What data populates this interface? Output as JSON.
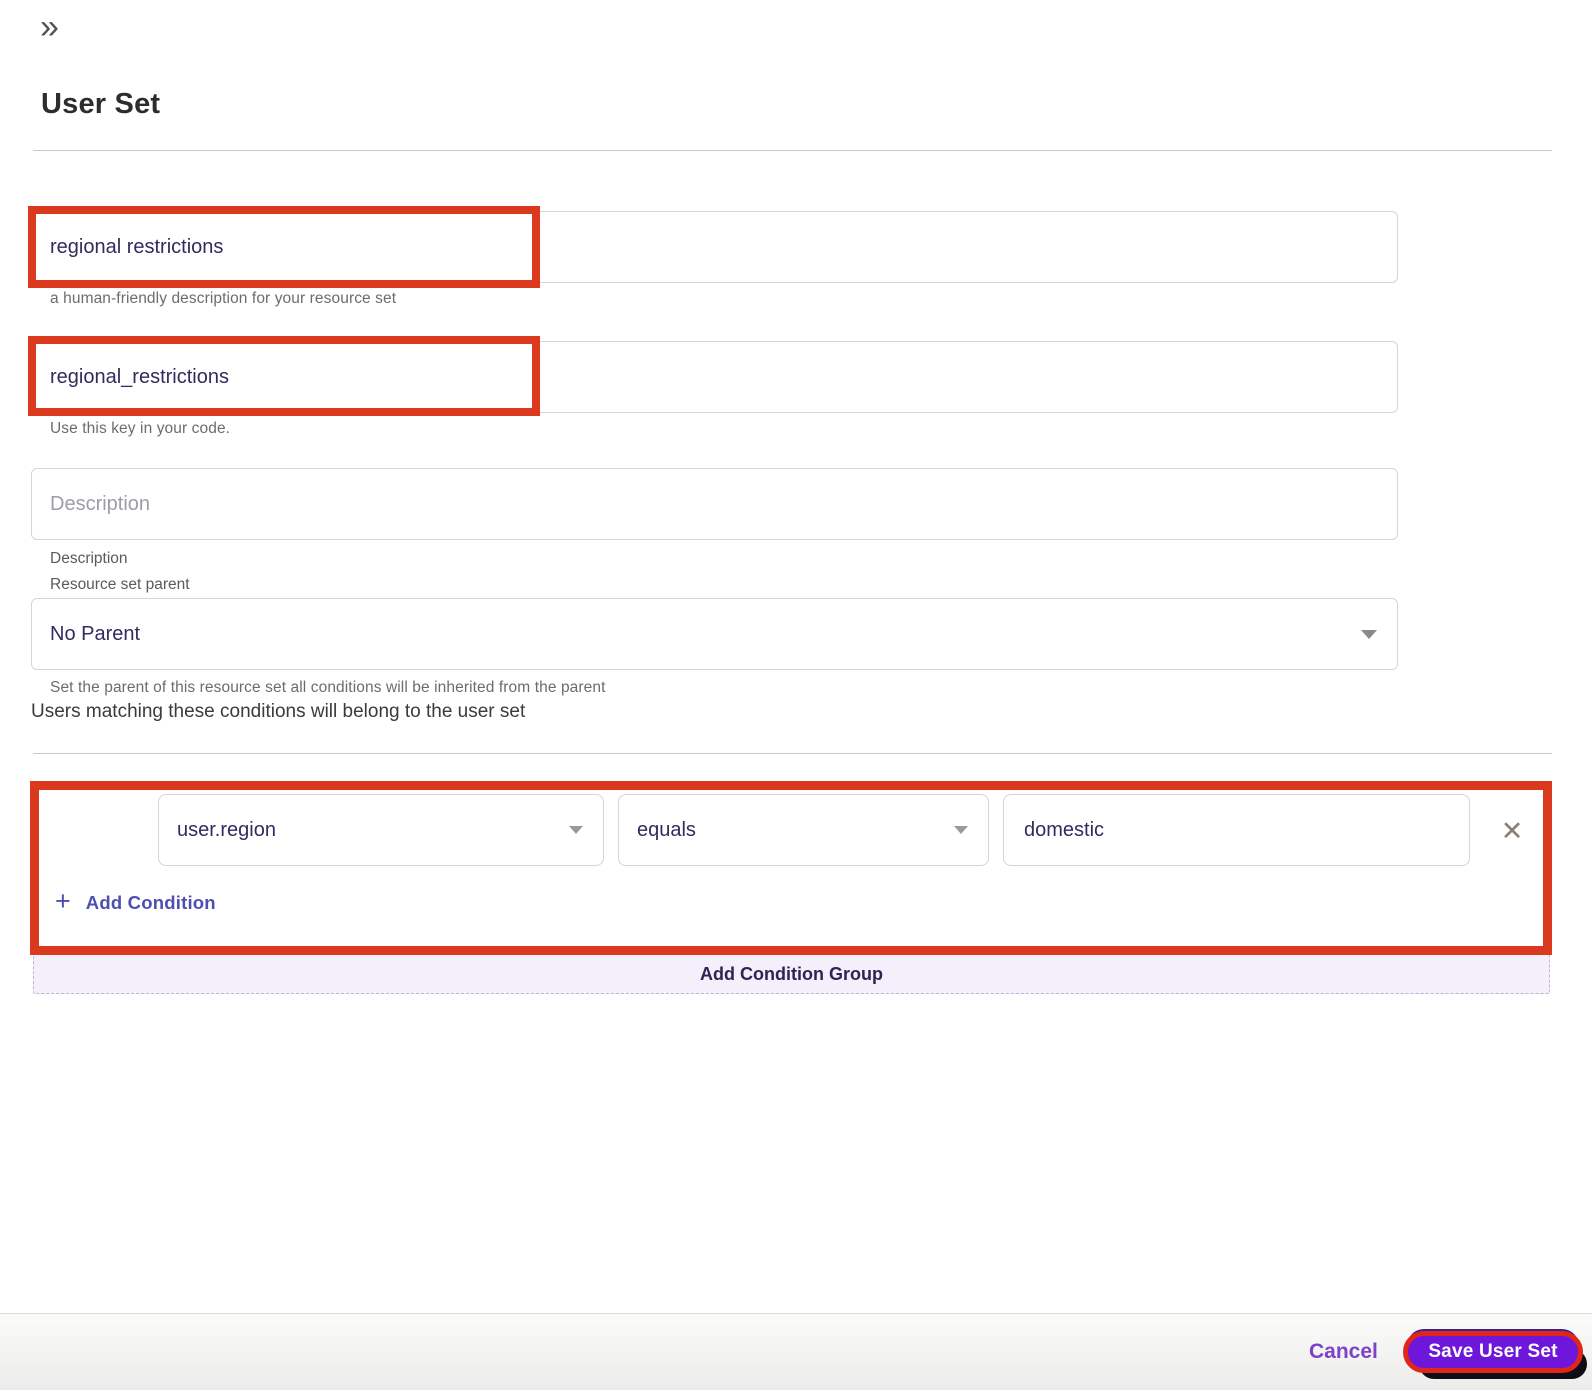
{
  "header": {
    "title": "User Set"
  },
  "icons": {
    "collapse": "»",
    "remove": "✕",
    "add": "+"
  },
  "form": {
    "name_field": {
      "value": "regional restrictions",
      "helper": "a human-friendly description for your resource set"
    },
    "key_field": {
      "value": "regional_restrictions",
      "helper": "Use this key in your code."
    },
    "description_field": {
      "placeholder": "Description",
      "label": "Description"
    },
    "parent_field": {
      "label": "Resource set parent",
      "selected": "No Parent",
      "helper": "Set the parent of this resource set all conditions will be inherited from the parent"
    }
  },
  "conditions": {
    "intro": "Users matching these conditions will belong to the user set",
    "rows": [
      {
        "attribute": "user.region",
        "operator": "equals",
        "value": "domestic"
      }
    ],
    "add_condition_label": "Add Condition",
    "add_condition_group_label": "Add Condition Group"
  },
  "footer": {
    "cancel_label": "Cancel",
    "save_label": "Save User Set"
  },
  "colors": {
    "annotation_red": "#da391d",
    "primary_purple": "#6e16d9",
    "link_purple": "#7d42c9",
    "accent_indigo": "#4c50b2",
    "input_text": "#322b5f",
    "group_button_bg": "#f5eefb"
  }
}
